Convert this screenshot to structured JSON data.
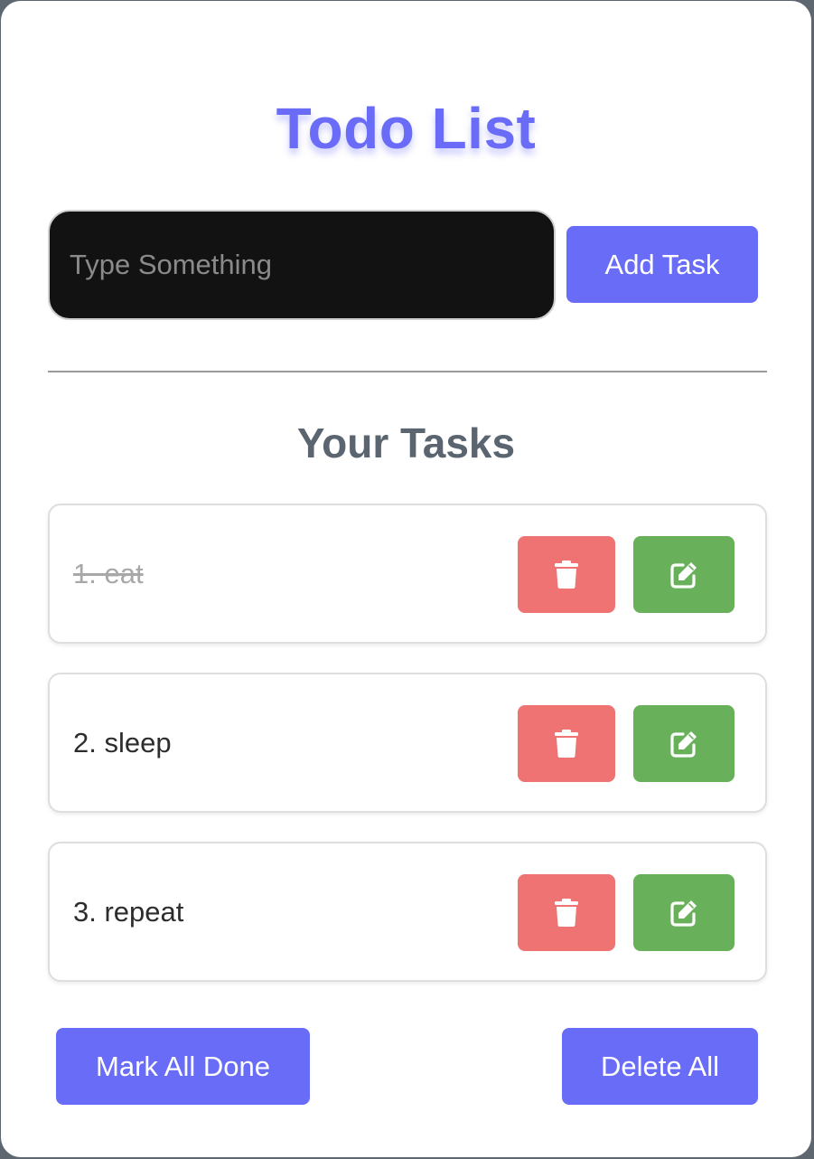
{
  "header": {
    "title": "Todo List"
  },
  "input": {
    "placeholder": "Type Something",
    "value": ""
  },
  "add_button": {
    "label": "Add Task"
  },
  "tasks_section": {
    "heading": "Your Tasks"
  },
  "tasks": [
    {
      "label": "1. eat",
      "completed": true,
      "delete_icon": "trash-icon",
      "edit_icon": "edit-icon"
    },
    {
      "label": "2. sleep",
      "completed": false,
      "delete_icon": "trash-icon",
      "edit_icon": "edit-icon"
    },
    {
      "label": "3. repeat",
      "completed": false,
      "delete_icon": "trash-icon",
      "edit_icon": "edit-icon"
    }
  ],
  "footer": {
    "mark_all_label": "Mark All Done",
    "delete_all_label": "Delete All"
  },
  "colors": {
    "accent": "#686cf7",
    "delete": "#ee7372",
    "edit": "#68b05a",
    "heading": "#5a6570",
    "input_bg": "#121212"
  }
}
